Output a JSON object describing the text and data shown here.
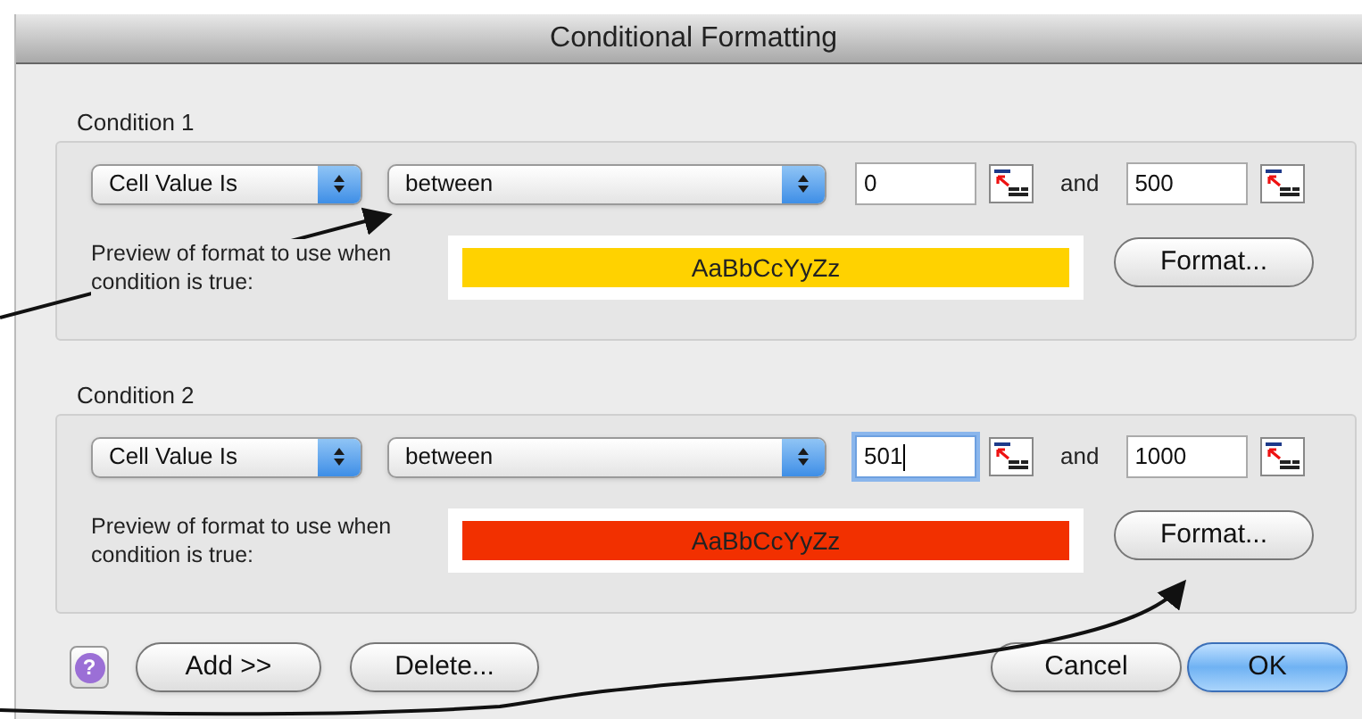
{
  "window": {
    "title": "Conditional Formatting"
  },
  "conditions": [
    {
      "title": "Condition 1",
      "type_popup": "Cell Value Is",
      "operator_popup": "between",
      "value1": {
        "value": "0",
        "focused": false
      },
      "and_label": "and",
      "value2": {
        "value": "500",
        "focused": false
      },
      "preview_label": "Preview of format to use when condition is true:",
      "preview": {
        "sample": "AaBbCcYyZz",
        "color": "#ffd200"
      },
      "format_button": "Format..."
    },
    {
      "title": "Condition 2",
      "type_popup": "Cell Value Is",
      "operator_popup": "between",
      "value1": {
        "value": "501",
        "focused": true
      },
      "and_label": "and",
      "value2": {
        "value": "1000",
        "focused": false
      },
      "preview_label": "Preview of format to use when condition is true:",
      "preview": {
        "sample": "AaBbCcYyZz",
        "color": "#f23000"
      },
      "format_button": "Format..."
    }
  ],
  "buttons": {
    "help": "?",
    "add": "Add >>",
    "delete": "Delete...",
    "cancel": "Cancel",
    "ok": "OK"
  }
}
